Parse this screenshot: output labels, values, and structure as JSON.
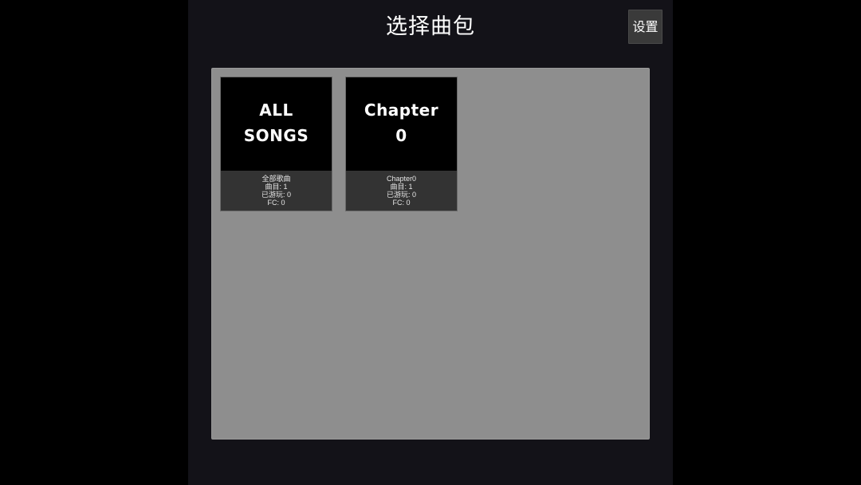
{
  "header": {
    "title": "选择曲包",
    "settings_label": "设置"
  },
  "packs": [
    {
      "cover_text": "ALL\nSONGS",
      "name": "全部歌曲",
      "songs": "曲目: 1",
      "played": "已游玩: 0",
      "fc": "FC: 0"
    },
    {
      "cover_text": "Chapter\n0",
      "name": "Chapter0",
      "songs": "曲目: 1",
      "played": "已游玩: 0",
      "fc": "FC: 0"
    }
  ],
  "colors": {
    "background": "#000000",
    "stage": "#131218",
    "panel": "#8e8e8e",
    "card_info": "#333333",
    "button": "#3a3a3a"
  }
}
